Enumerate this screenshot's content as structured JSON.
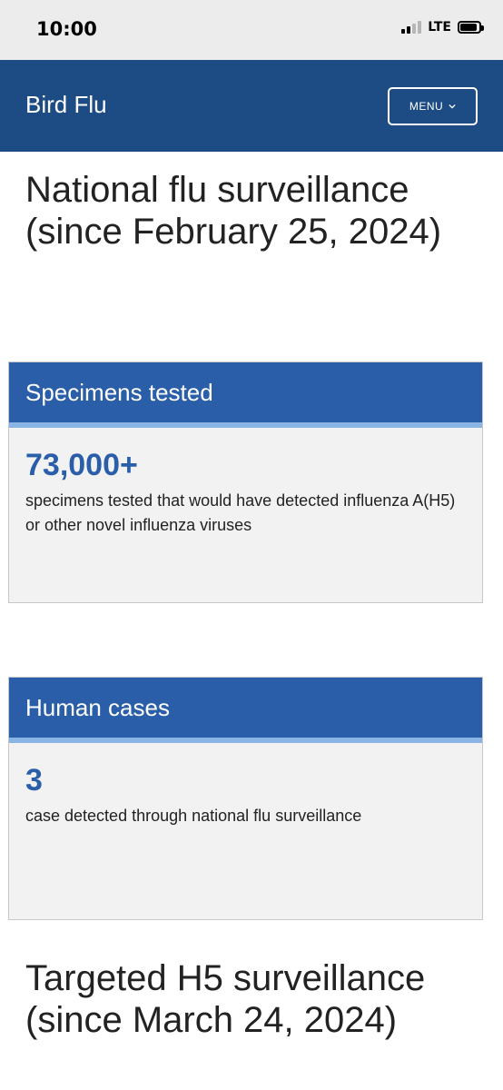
{
  "status_bar": {
    "time": "10:00",
    "network": "LTE"
  },
  "header": {
    "title": "Bird Flu",
    "menu_label": "MENU"
  },
  "sections": [
    {
      "heading": "National flu surveillance (since February 25, 2024)"
    },
    {
      "heading": "Targeted H5 surveillance (since March 24, 2024)"
    }
  ],
  "cards": [
    {
      "title": "Specimens tested",
      "value": "73,000+",
      "description": "specimens tested that would have detected influenza A(H5) or other novel influenza viruses"
    },
    {
      "title": "Human cases",
      "value": "3",
      "description": "case detected through national flu surveillance"
    }
  ],
  "colors": {
    "header_bg": "#1d4c85",
    "card_header_bg": "#2a5ea8",
    "card_header_underline": "#8ab4e3",
    "value_text": "#2a5ea8",
    "card_bg": "#f2f2f2"
  },
  "icons": [
    "signal-icon",
    "battery-icon",
    "chevron-down-icon"
  ]
}
